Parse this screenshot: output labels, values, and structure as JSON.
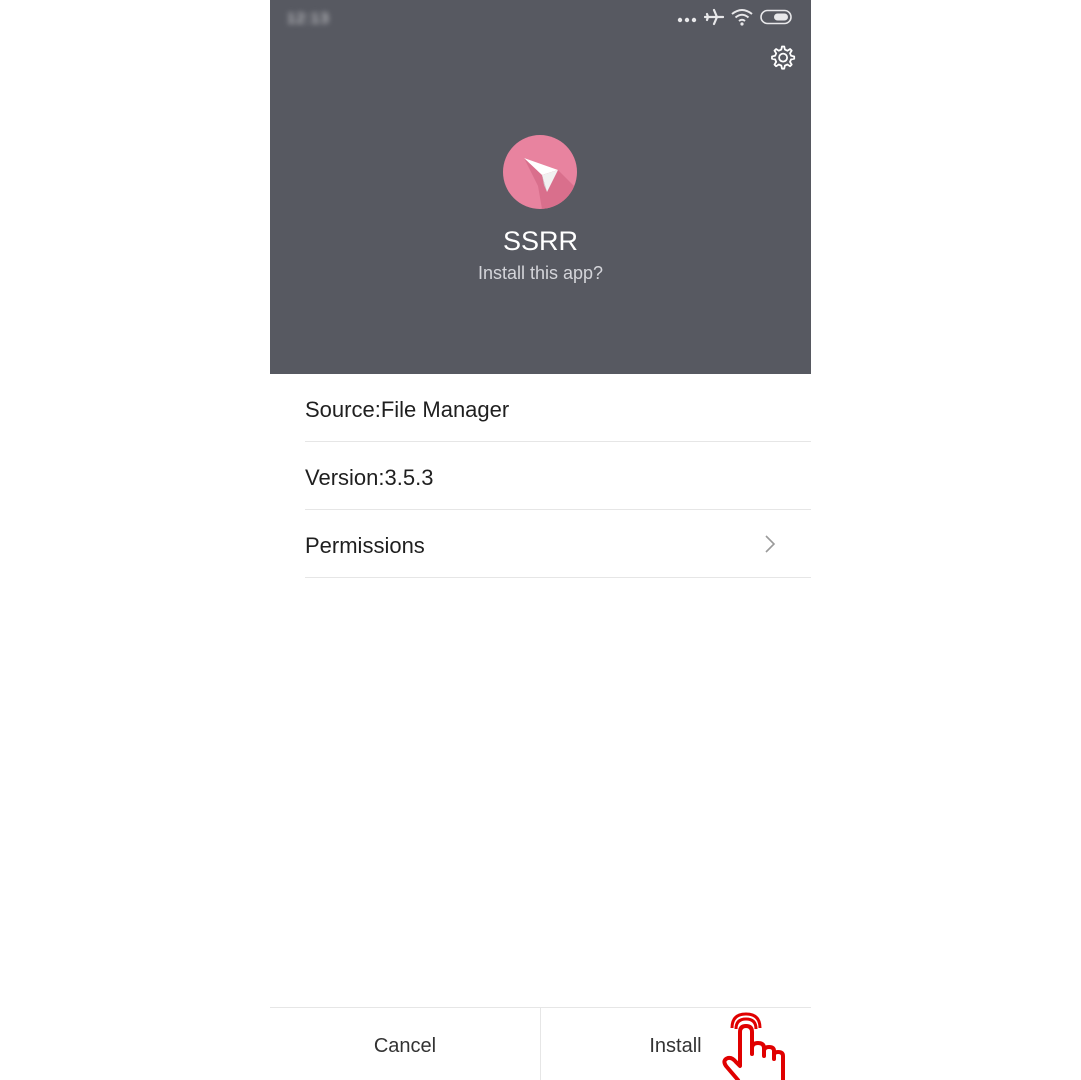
{
  "status_bar": {
    "time": "12:13",
    "icons": [
      "signal-dots-icon",
      "airplane-icon",
      "wifi-icon",
      "battery-icon"
    ]
  },
  "header": {
    "settings_icon": "gear-icon",
    "app_icon": "paper-plane-icon",
    "app_name": "SSRR",
    "prompt": "Install this app?",
    "background_color": "#575961",
    "icon_color": "#e8839f"
  },
  "info": {
    "source": "Source:File Manager",
    "version": "Version:3.5.3",
    "permissions": "Permissions",
    "permissions_icon": "chevron-right-icon"
  },
  "actions": {
    "cancel": "Cancel",
    "install": "Install"
  },
  "overlay": {
    "pointer_icon": "hand-pointer-icon",
    "pointer_color": "#e00000"
  }
}
